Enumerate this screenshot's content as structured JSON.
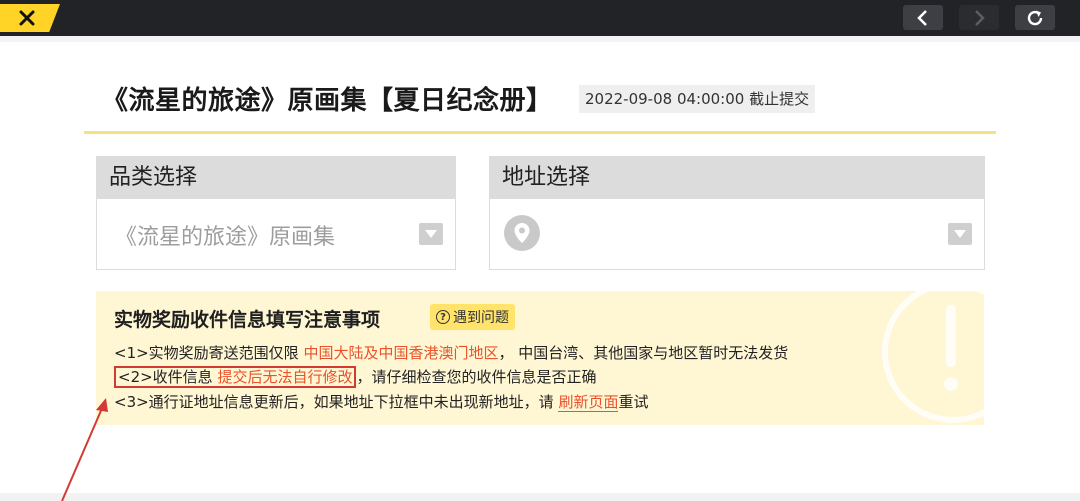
{
  "topbar": {
    "close_icon": "close-x-icon",
    "back_icon": "chevron-left-icon",
    "forward_icon": "chevron-right-icon",
    "refresh_icon": "refresh-icon"
  },
  "page": {
    "title": "《流星的旅途》原画集【夏日纪念册】",
    "deadline": "2022-09-08 04:00:00 截止提交"
  },
  "category_select": {
    "header": "品类选择",
    "value": "《流星的旅途》原画集"
  },
  "address_select": {
    "header": "地址选择",
    "value": ""
  },
  "notice": {
    "title": "实物奖励收件信息填写注意事项",
    "help_button": "遇到问题",
    "line1": {
      "prefix": "<1>实物奖励寄送范围仅限 ",
      "highlight": "中国大陆及中国香港澳门地区",
      "suffix": "， 中国台湾、其他国家与地区暂时无法发货"
    },
    "line2": {
      "prefix": "<2>收件信息 ",
      "highlight": "提交后无法自行修改",
      "suffix": "，请仔细检查您的收件信息是否正确"
    },
    "line3": {
      "prefix": "<3>通行证地址信息更新后，如果地址下拉框中未出现新地址，请 ",
      "link": "刷新页面",
      "suffix": "重试"
    }
  },
  "colors": {
    "accent_yellow": "#ffd426",
    "highlight_orange": "#e8532b",
    "annotation_red": "#d23b34",
    "notice_bg": "#fff6d4"
  }
}
